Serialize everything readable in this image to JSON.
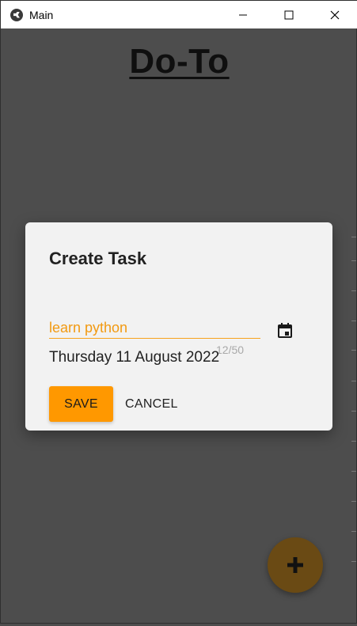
{
  "window": {
    "title": "Main",
    "controls": [
      "minimize",
      "maximize",
      "close"
    ]
  },
  "app": {
    "title": "Do-To"
  },
  "dialog": {
    "title": "Create Task",
    "task_input": {
      "value": "learn python",
      "counter": "12/50"
    },
    "date_text": "Thursday 11 August 2022",
    "calendar_icon": "calendar-icon",
    "buttons": {
      "save_label": "SAVE",
      "cancel_label": "CANCEL"
    }
  },
  "fab": {
    "icon": "plus-icon"
  },
  "colors": {
    "accent": "#ff9800",
    "input_text": "#f29a12",
    "background_overlay": "#4d4d4d",
    "dialog_bg": "#f2f2f2",
    "fab_bg": "#6a4a14"
  }
}
